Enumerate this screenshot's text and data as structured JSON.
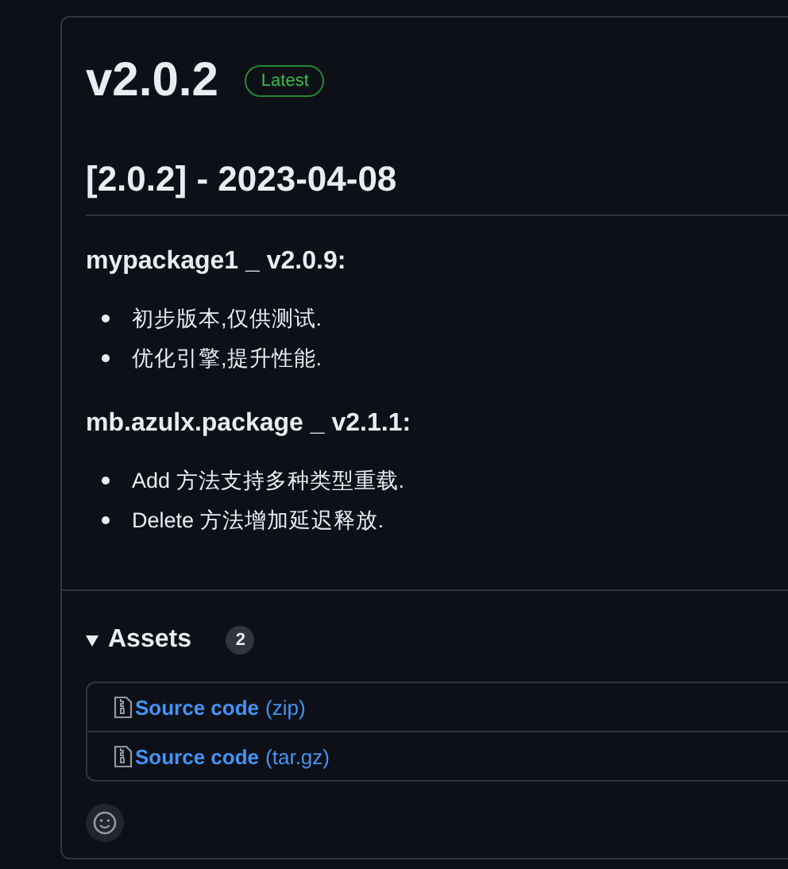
{
  "release": {
    "title": "v2.0.2",
    "badge": "Latest"
  },
  "body": {
    "heading": "[2.0.2] - 2023-04-08",
    "sections": [
      {
        "title": "mypackage1 _ v2.0.9:",
        "items": [
          "初步版本,仅供测试.",
          "优化引擎,提升性能."
        ]
      },
      {
        "title": "mb.azulx.package _ v2.1.1:",
        "items": [
          "Add 方法支持多种类型重载.",
          "Delete 方法增加延迟释放."
        ]
      }
    ]
  },
  "assets": {
    "title": "Assets",
    "count": "2",
    "expanded": true,
    "items": [
      {
        "name": "Source code",
        "ext": "(zip)"
      },
      {
        "name": "Source code",
        "ext": "(tar.gz)"
      }
    ]
  }
}
